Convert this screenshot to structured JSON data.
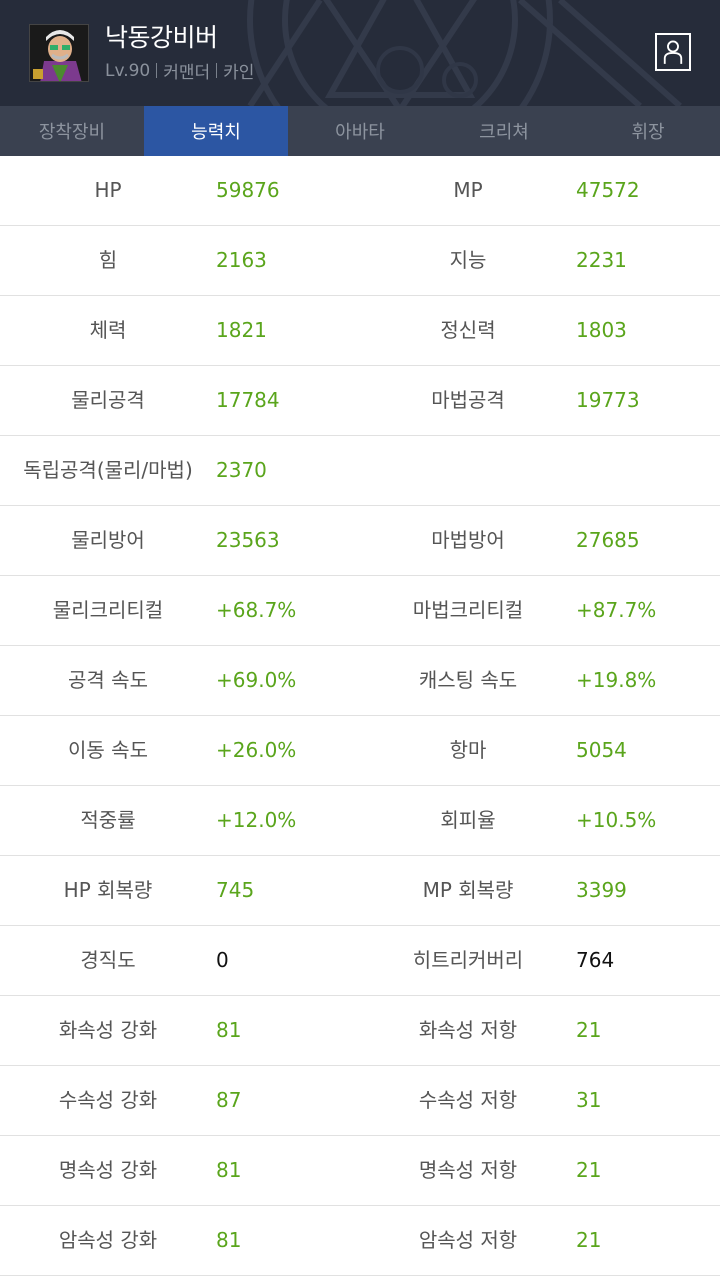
{
  "header": {
    "character_name": "낙동강비버",
    "level": "Lv.90",
    "job": "커맨더",
    "server": "카인",
    "avatar_icon": "character-portrait",
    "profile_icon": "person-icon"
  },
  "tabs": [
    {
      "label": "장착장비",
      "active": false
    },
    {
      "label": "능력치",
      "active": true
    },
    {
      "label": "아바타",
      "active": false
    },
    {
      "label": "크리쳐",
      "active": false
    },
    {
      "label": "휘장",
      "active": false
    }
  ],
  "colors": {
    "value_green": "#5aa51c",
    "tab_active": "#2c56a3",
    "header_bg": "#262c3a",
    "tab_bar_bg": "#3a4150"
  },
  "stats": [
    {
      "l1": "HP",
      "v1": "59876",
      "l2": "MP",
      "v2": "47572"
    },
    {
      "l1": "힘",
      "v1": "2163",
      "l2": "지능",
      "v2": "2231"
    },
    {
      "l1": "체력",
      "v1": "1821",
      "l2": "정신력",
      "v2": "1803"
    },
    {
      "l1": "물리공격",
      "v1": "17784",
      "l2": "마법공격",
      "v2": "19773"
    },
    {
      "l1": "독립공격(물리/마법)",
      "v1": "2370",
      "l2": "",
      "v2": ""
    },
    {
      "l1": "물리방어",
      "v1": "23563",
      "l2": "마법방어",
      "v2": "27685"
    },
    {
      "l1": "물리크리티컬",
      "v1": "+68.7%",
      "l2": "마법크리티컬",
      "v2": "+87.7%"
    },
    {
      "l1": "공격 속도",
      "v1": "+69.0%",
      "l2": "캐스팅 속도",
      "v2": "+19.8%"
    },
    {
      "l1": "이동 속도",
      "v1": "+26.0%",
      "l2": "항마",
      "v2": "5054"
    },
    {
      "l1": "적중률",
      "v1": "+12.0%",
      "l2": "회피율",
      "v2": "+10.5%"
    },
    {
      "l1": "HP 회복량",
      "v1": "745",
      "l2": "MP 회복량",
      "v2": "3399"
    },
    {
      "l1": "경직도",
      "v1": "0",
      "l2": "히트리커버리",
      "v2": "764",
      "black": true
    },
    {
      "l1": "화속성 강화",
      "v1": "81",
      "l2": "화속성 저항",
      "v2": "21"
    },
    {
      "l1": "수속성 강화",
      "v1": "87",
      "l2": "수속성 저항",
      "v2": "31"
    },
    {
      "l1": "명속성 강화",
      "v1": "81",
      "l2": "명속성 저항",
      "v2": "21"
    },
    {
      "l1": "암속성 강화",
      "v1": "81",
      "l2": "암속성 저항",
      "v2": "21"
    }
  ]
}
